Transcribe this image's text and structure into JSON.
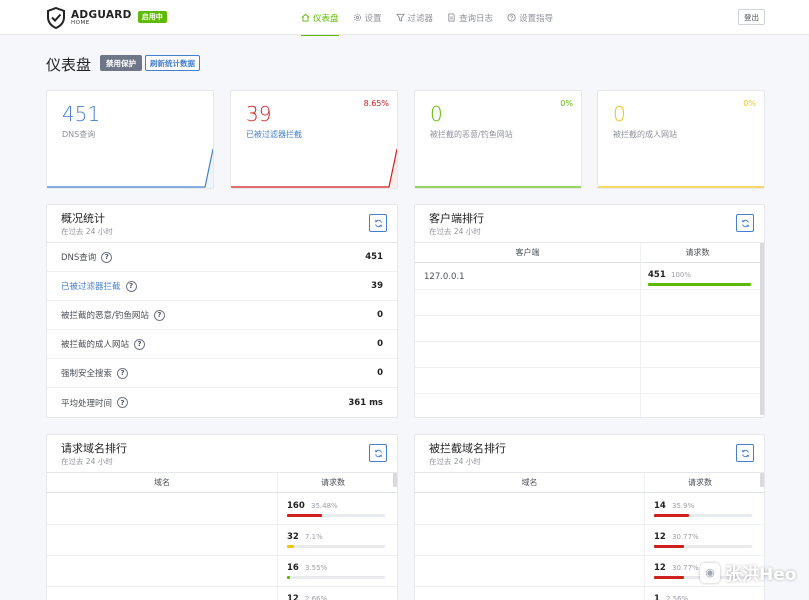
{
  "header": {
    "logo_main": "ADGUARD",
    "logo_sub": "HOME",
    "status_badge": "启用中",
    "nav": [
      {
        "label": "仪表盘",
        "icon": "home-icon"
      },
      {
        "label": "设置",
        "icon": "gear-icon"
      },
      {
        "label": "过滤器",
        "icon": "filter-icon"
      },
      {
        "label": "查询日志",
        "icon": "document-icon"
      },
      {
        "label": "设置指导",
        "icon": "help-circle-icon"
      }
    ],
    "logout": "登出"
  },
  "page": {
    "title": "仪表盘",
    "disable_protection": "禁用保护",
    "refresh_stats": "刷新统计数据"
  },
  "stats": [
    {
      "value": "451",
      "label": "DNS查询",
      "percent": "",
      "color": "#467fcf"
    },
    {
      "value": "39",
      "label": "已被过滤器拦截",
      "percent": "8.65%",
      "color": "#cd201f"
    },
    {
      "value": "0",
      "label": "被拦截的恶意/钓鱼网站",
      "percent": "0%",
      "color": "#5eba00"
    },
    {
      "value": "0",
      "label": "被拦截的成人网站",
      "percent": "0%",
      "color": "#f1c40f"
    }
  ],
  "overview": {
    "title": "概况统计",
    "subtitle": "在过去 24 小时",
    "rows": [
      {
        "label": "DNS查询",
        "value": "451"
      },
      {
        "label": "已被过滤器拦截",
        "value": "39"
      },
      {
        "label": "被拦截的恶意/钓鱼网站",
        "value": "0"
      },
      {
        "label": "被拦截的成人网站",
        "value": "0"
      },
      {
        "label": "强制安全搜索",
        "value": "0"
      },
      {
        "label": "平均处理时间",
        "value": "361 ms"
      }
    ]
  },
  "clients": {
    "title": "客户端排行",
    "subtitle": "在过去 24 小时",
    "col_client": "客户端",
    "col_requests": "请求数",
    "rows": [
      {
        "client": "127.0.0.1",
        "count": "451",
        "percent": "100%",
        "fraction": 1.0
      }
    ]
  },
  "top_domains": {
    "title": "请求域名排行",
    "subtitle": "在过去 24 小时",
    "col_domain": "域名",
    "col_requests": "请求数",
    "rows": [
      {
        "count": "160",
        "percent": "35.48%",
        "fraction": 0.3548,
        "color": "#cd201f"
      },
      {
        "count": "32",
        "percent": "7.1%",
        "fraction": 0.071,
        "color": "#f1c40f"
      },
      {
        "count": "16",
        "percent": "3.55%",
        "fraction": 0.0355,
        "color": "#5eba00"
      },
      {
        "count": "12",
        "percent": "2.66%",
        "fraction": 0.0266,
        "color": "#5eba00"
      }
    ]
  },
  "blocked_domains": {
    "title": "被拦截域名排行",
    "subtitle": "在过去 24 小时",
    "col_domain": "域名",
    "col_requests": "请求数",
    "rows": [
      {
        "count": "14",
        "percent": "35.9%",
        "fraction": 0.359,
        "color": "#cd201f"
      },
      {
        "count": "12",
        "percent": "30.77%",
        "fraction": 0.3077,
        "color": "#cd201f"
      },
      {
        "count": "12",
        "percent": "30.77%",
        "fraction": 0.3077,
        "color": "#cd201f"
      },
      {
        "count": "1",
        "percent": "2.56%",
        "fraction": 0.0256,
        "color": "#cd201f"
      }
    ]
  },
  "watermark": "张洪Heo"
}
